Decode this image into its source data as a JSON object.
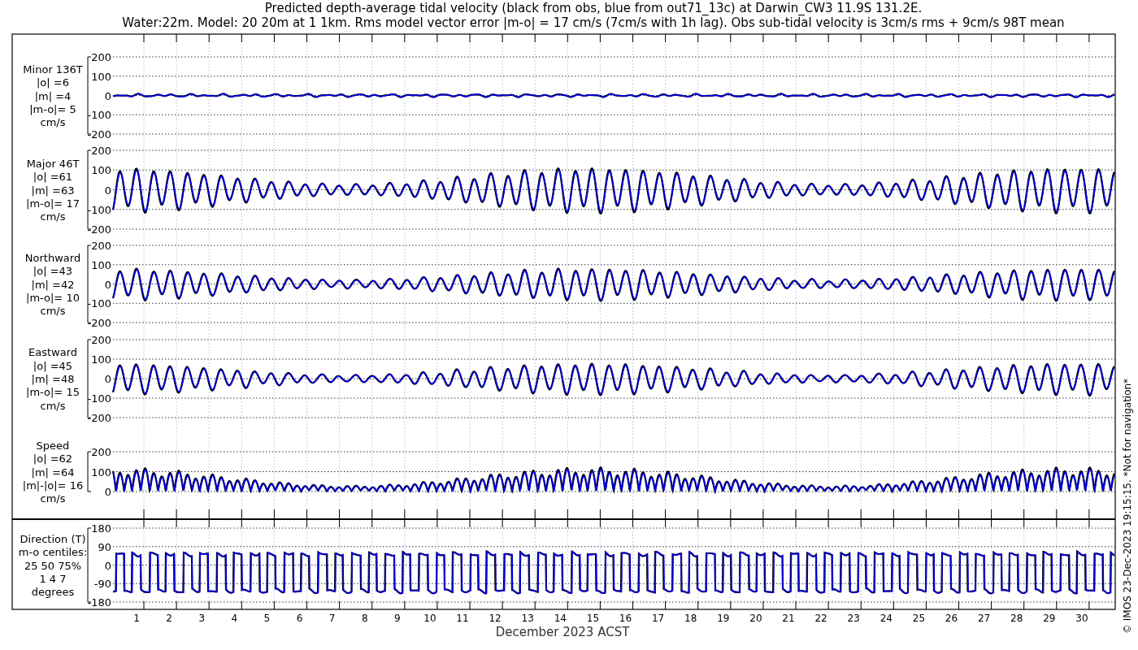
{
  "title": [
    "Predicted depth-average tidal velocity (black from obs, blue from out71_13c) at Darwin_CW3 11.9S 131.2E.",
    "Water:22m. Model: 20 20m at 1 1km. Rms model vector error |m-o| = 17 cm/s (7cm/s with 1h lag). Obs sub-tidal velocity is 3cm/s rms + 9cm/s 98T mean"
  ],
  "panels": [
    {
      "kind": "minor",
      "label_lines": [
        "Minor 136T",
        "|o| =6",
        "|m| =4",
        "|m-o|= 5",
        "cm/s"
      ],
      "yticks": [
        "200",
        "100",
        "0",
        "-100",
        "-200"
      ]
    },
    {
      "kind": "major",
      "label_lines": [
        "Major 46T",
        "|o| =61",
        "|m| =63",
        "|m-o|= 17",
        "cm/s"
      ],
      "yticks": [
        "200",
        "100",
        "0",
        "-100",
        "-200"
      ]
    },
    {
      "kind": "north",
      "label_lines": [
        "Northward",
        "|o| =43",
        "|m| =42",
        "|m-o|= 10",
        "cm/s"
      ],
      "yticks": [
        "200",
        "100",
        "0",
        "-100",
        "-200"
      ]
    },
    {
      "kind": "east",
      "label_lines": [
        "Eastward",
        "|o| =45",
        "|m| =48",
        "|m-o|= 15",
        "cm/s"
      ],
      "yticks": [
        "200",
        "100",
        "0",
        "-100",
        "-200"
      ]
    },
    {
      "kind": "speed",
      "label_lines": [
        "Speed",
        "|o| =62",
        "|m| =64",
        "|m|-|o|= 16",
        "cm/s"
      ],
      "yticks": [
        "200",
        "100",
        "0"
      ]
    },
    {
      "kind": "direction",
      "label_lines": [
        "Direction (T)",
        "m-o centiles:",
        "25  50  75%",
        "1   4   7",
        "degrees"
      ],
      "yticks": [
        "180",
        "90",
        "0",
        "-90",
        "-180"
      ]
    }
  ],
  "xticks": [
    "1",
    "2",
    "3",
    "4",
    "5",
    "6",
    "7",
    "8",
    "9",
    "10",
    "11",
    "12",
    "13",
    "14",
    "15",
    "16",
    "17",
    "18",
    "19",
    "20",
    "21",
    "22",
    "23",
    "24",
    "25",
    "26",
    "27",
    "28",
    "29",
    "30"
  ],
  "xlabel": "December 2023 ACST",
  "credit": "© IMOS 23-Dec-2023 19:15:15. *Not for navigation*"
}
